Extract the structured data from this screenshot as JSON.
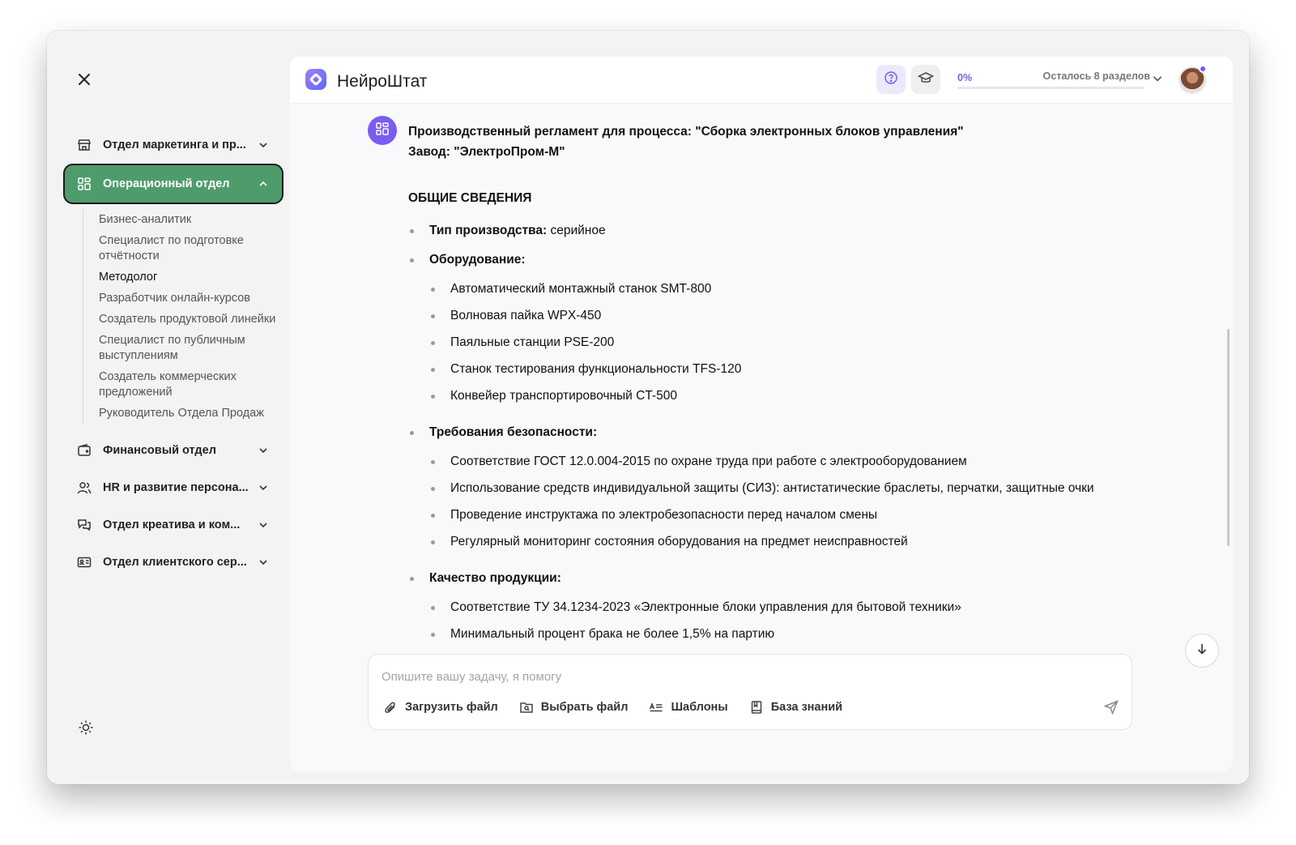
{
  "brand": {
    "name": "НейроШтат"
  },
  "header": {
    "progress_percent": "0%",
    "progress_value": 0,
    "remaining": "Осталось 8 разделов"
  },
  "sidebar": {
    "items": [
      {
        "label": "Отдел маркетинга и пр...",
        "icon": "store-icon"
      },
      {
        "label": "Операционный отдел",
        "icon": "grid-icon",
        "active": true
      },
      {
        "label": "Финансовый отдел",
        "icon": "wallet-icon"
      },
      {
        "label": "HR и развитие персона...",
        "icon": "users-icon"
      },
      {
        "label": "Отдел креатива и ком...",
        "icon": "chat-icon"
      },
      {
        "label": "Отдел клиентского сер...",
        "icon": "id-card-icon"
      }
    ],
    "subitems": [
      "Бизнес-аналитик",
      "Специалист по подготовке отчётности",
      "Методолог",
      "Разработчик онлайн-курсов",
      "Создатель продуктовой линейки",
      "Специалист по публичным выступлениям",
      "Создатель коммерческих предложений",
      "Руководитель Отдела Продаж"
    ]
  },
  "message": {
    "title_line1": "Производственный регламент для процесса: \"Сборка электронных блоков управления\"",
    "title_line2": "Завод: \"ЭлектроПром-М\"",
    "heading": "ОБЩИЕ СВЕДЕНИЯ",
    "type_label": "Тип производства:",
    "type_value": " серийное",
    "equipment_label": "Оборудование:",
    "equipment": [
      "Автоматический монтажный станок SMT-800",
      "Волновая пайка WPX-450",
      "Паяльные станции PSE-200",
      "Станок тестирования функциональности TFS-120",
      "Конвейер транспортировочный CT-500"
    ],
    "safety_label": "Требования безопасности:",
    "safety": [
      "Соответствие ГОСТ 12.0.004-2015 по охране труда при работе с электрооборудованием",
      "Использование средств индивидуальной защиты (СИЗ): антистатические браслеты, перчатки, защитные очки",
      "Проведение инструктажа по электробезопасности перед началом смены",
      "Регулярный мониторинг состояния оборудования на предмет неисправностей"
    ],
    "quality_label": "Качество продукции:",
    "quality": [
      "Соответствие ТУ 34.1234-2023 «Электронные блоки управления для бытовой техники»",
      "Минимальный процент брака не более 1,5% на партию"
    ]
  },
  "composer": {
    "placeholder": "Опишите вашу задачу, я помогу",
    "tools": {
      "upload": "Загрузить файл",
      "choose": "Выбрать файл",
      "templates": "Шаблоны",
      "knowledge": "База знаний"
    }
  },
  "colors": {
    "accent": "#7a5cf0",
    "active_nav": "#4e9c6c"
  }
}
